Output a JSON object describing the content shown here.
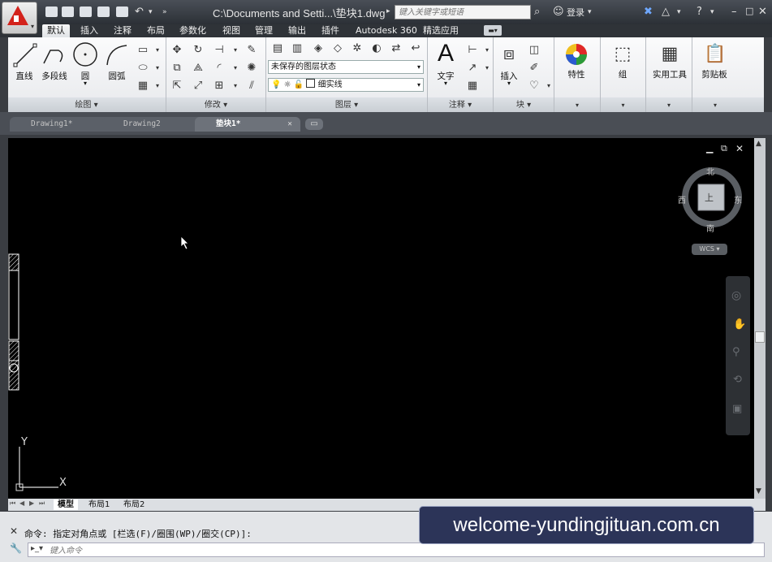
{
  "window": {
    "title": "C:\\Documents and Setti...\\垫块1.dwg",
    "search_placeholder": "键入关键字或短语",
    "login": "登录"
  },
  "ribbon_tabs": [
    "默认",
    "插入",
    "注释",
    "布局",
    "参数化",
    "视图",
    "管理",
    "输出",
    "插件",
    "Autodesk 360",
    "精选应用"
  ],
  "active_ribbon_tab": "默认",
  "draw_panel": {
    "title": "绘图 ▾",
    "tools": [
      "直线",
      "多段线",
      "圆",
      "圆弧"
    ]
  },
  "modify_panel": {
    "title": "修改 ▾"
  },
  "layer_panel": {
    "title": "图层 ▾",
    "layer_state": "未保存的图层状态",
    "current_layer": "细实线"
  },
  "annotation_panel": {
    "title": "注释 ▾",
    "text_label": "文字"
  },
  "block_panel": {
    "title": "块 ▾",
    "insert_label": "插入"
  },
  "big_buttons": [
    "特性",
    "组",
    "实用工具",
    "剪贴板"
  ],
  "doc_tabs": [
    {
      "label": "Drawing1*",
      "active": false
    },
    {
      "label": "Drawing2",
      "active": false
    },
    {
      "label": "垫块1*",
      "active": true
    }
  ],
  "viewcube": {
    "north": "北",
    "south": "南",
    "east": "东",
    "west": "西",
    "face": "上",
    "wcs": "WCS ▾"
  },
  "ucs": {
    "x": "X",
    "y": "Y"
  },
  "layout_tabs": [
    {
      "label": "模型",
      "active": true
    },
    {
      "label": "布局1",
      "active": false
    },
    {
      "label": "布局2",
      "active": false
    }
  ],
  "command": {
    "history": "命令: 指定对角点或 [栏选(F)/圈围(WP)/圈交(CP)]:",
    "input_placeholder": "键入命令"
  },
  "watermark": "welcome-yundingjituan.com.cn"
}
